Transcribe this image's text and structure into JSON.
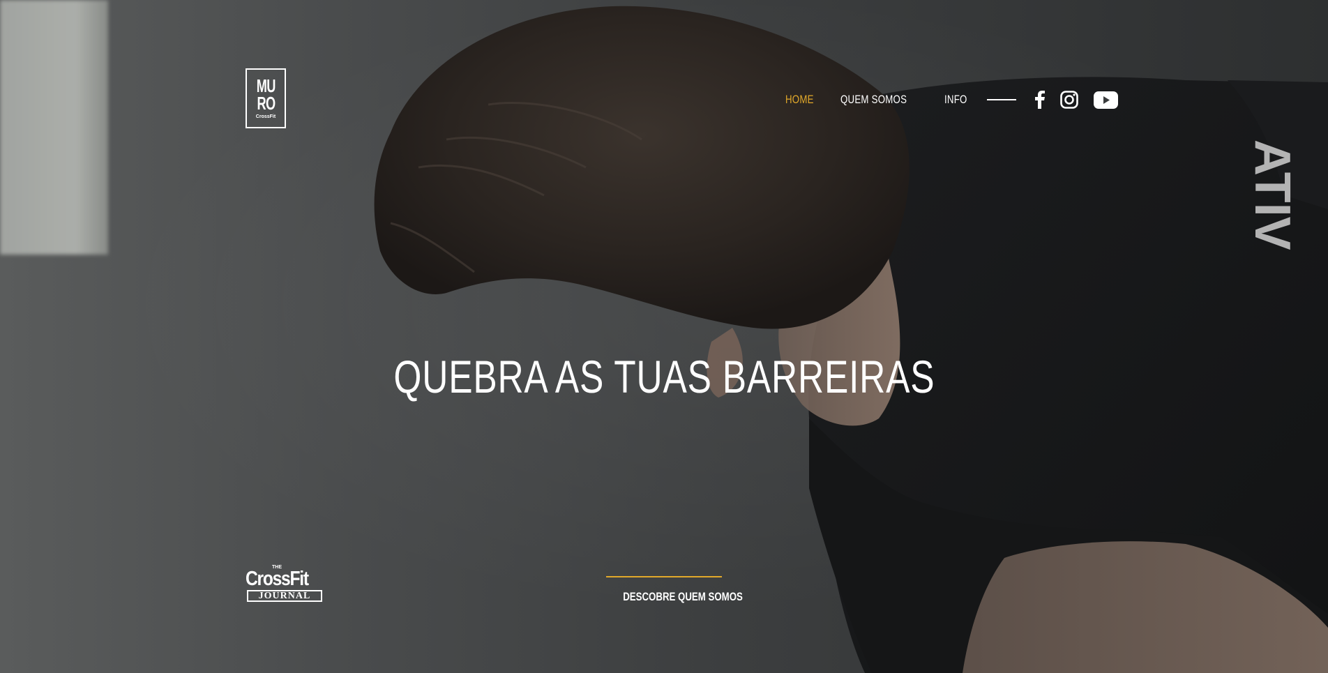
{
  "brand": {
    "logo_line1": "MU",
    "logo_line2": "RO",
    "logo_line3": "CrossFit"
  },
  "nav": {
    "items": [
      {
        "label": "HOME",
        "active": true
      },
      {
        "label": "QUEM SOMOS",
        "active": false
      },
      {
        "label": "INFO",
        "active": false
      }
    ],
    "social": [
      "facebook-icon",
      "instagram-icon",
      "youtube-icon"
    ]
  },
  "hero": {
    "headline": "QUEBRA AS TUAS BARREIRAS"
  },
  "partner": {
    "the": "THE",
    "name": "CrossFit",
    "sub": "JOURNAL"
  },
  "cta": {
    "label": "DESCOBRE QUEM SOMOS"
  },
  "colors": {
    "accent": "#e2a92a",
    "text": "#ffffff",
    "background": "#3a3c3d"
  }
}
